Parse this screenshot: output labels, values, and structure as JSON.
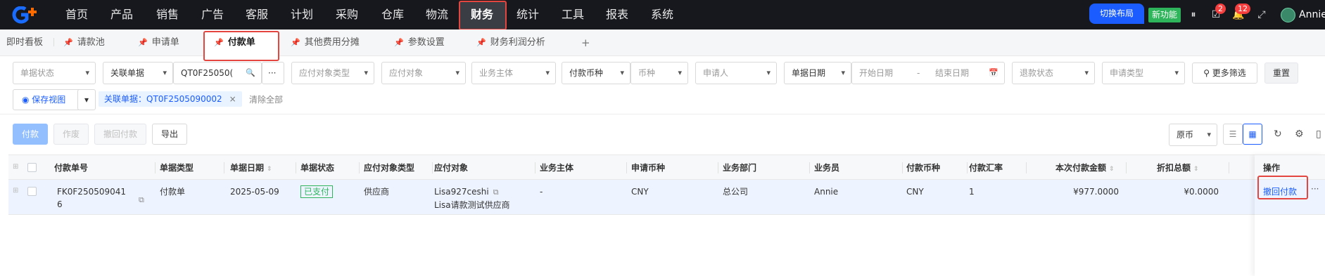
{
  "nav": {
    "items": [
      "首页",
      "产品",
      "销售",
      "广告",
      "客服",
      "计划",
      "采购",
      "仓库",
      "物流",
      "财务",
      "统计",
      "工具",
      "报表",
      "系统"
    ],
    "active": "财务",
    "switch_layout": "切换布局",
    "new_feature": "新功能",
    "badge_tasks": "2",
    "badge_notifications": "12",
    "username": "Annie"
  },
  "tabs": {
    "dashboard": "即时看板",
    "items": [
      "请款池",
      "申请单",
      "付款单",
      "其他费用分摊",
      "参数设置",
      "财务利润分析"
    ],
    "active": "付款单",
    "add": "+"
  },
  "filters": {
    "doc_status": "单据状态",
    "related_doc": "关联单据",
    "related_doc_value": "QT0F25050(",
    "payee_type": "应付对象类型",
    "payee": "应付对象",
    "business_entity": "业务主体",
    "payment_currency": "付款币种",
    "currency": "币种",
    "applicant": "申请人",
    "doc_date": "单据日期",
    "start_date": "开始日期",
    "date_sep": "-",
    "end_date": "结束日期",
    "refund_status": "退款状态",
    "apply_type": "申请类型",
    "more_filters": "更多筛选",
    "reset": "重置",
    "save_view": "保存视图",
    "chip": "关联单据：QT0F2505090002",
    "clear_all": "清除全部"
  },
  "toolbar": {
    "pay": "付款",
    "void": "作废",
    "revoke_pay": "撤回付款",
    "export": "导出",
    "currency_view": "原币"
  },
  "table": {
    "columns": [
      "付款单号",
      "单据类型",
      "单据日期",
      "单据状态",
      "应付对象类型",
      "应付对象",
      "业务主体",
      "申请币种",
      "业务部门",
      "业务员",
      "付款币种",
      "付款汇率",
      "本次付款金额",
      "折扣总额"
    ],
    "ops_header": "操作",
    "rows": [
      {
        "payment_no_line1": "FK0F250509041",
        "payment_no_line2": "6",
        "doc_type": "付款单",
        "doc_date": "2025-05-09",
        "status": "已支付",
        "payee_type": "供应商",
        "payee_line1": "Lisa927ceshi",
        "payee_line2": "Lisa请款测试供应商",
        "business_entity": "-",
        "apply_currency": "CNY",
        "department": "总公司",
        "salesperson": "Annie",
        "pay_currency": "CNY",
        "exchange_rate": "1",
        "amount": "¥977.0000",
        "discount": "¥0.0000",
        "op_revoke": "撤回付款",
        "op_more": "···"
      }
    ]
  },
  "colors": {
    "topbar_bg": "#16181d",
    "accent": "#1a5cff",
    "highlight_red": "#e5453f",
    "status_green": "#2eb55b",
    "badge_red": "#f53f3f"
  }
}
